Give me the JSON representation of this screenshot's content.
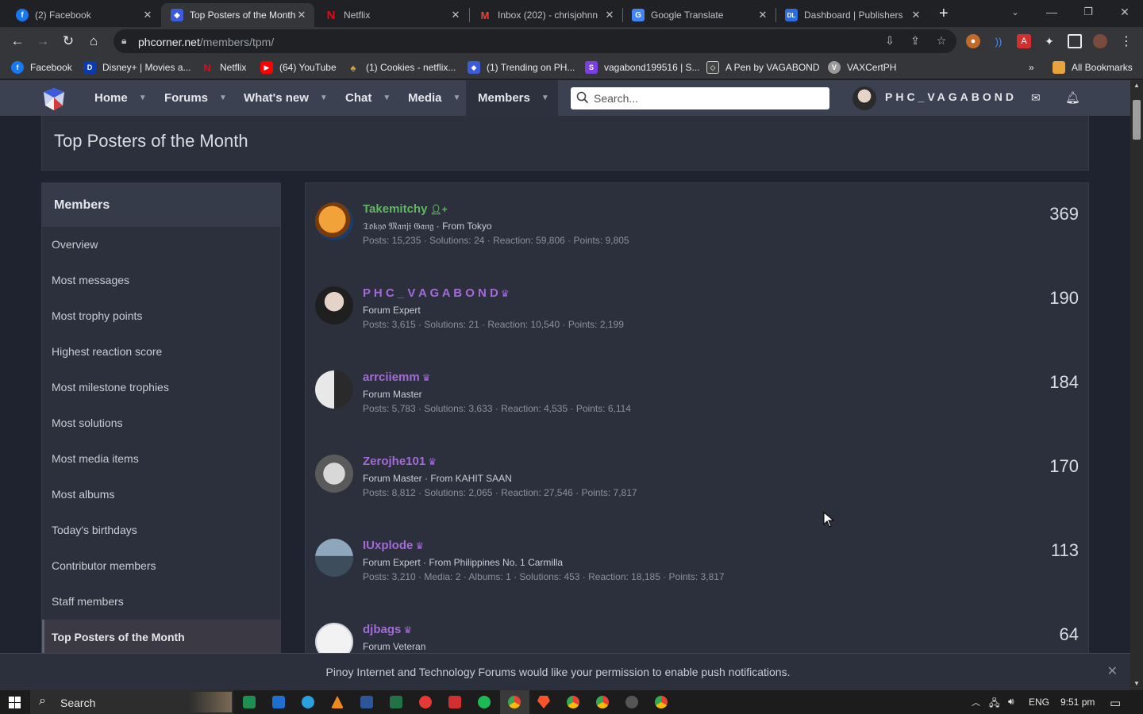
{
  "tabs": [
    {
      "title": "(2) Facebook",
      "favicon": "facebook-icon",
      "color": "#1877f2"
    },
    {
      "title": "Top Posters of the Month",
      "favicon": "phc-icon",
      "color": "#3b5bdb",
      "active": true
    },
    {
      "title": "Netflix",
      "favicon": "netflix-icon",
      "color": "#e50914"
    },
    {
      "title": "Inbox (202) - chrisjohnn",
      "favicon": "gmail-icon",
      "color": "#ea4335"
    },
    {
      "title": "Google Translate",
      "favicon": "translate-icon",
      "color": "#4285f4"
    },
    {
      "title": "Dashboard | Publishers",
      "favicon": "dl-icon",
      "color": "#2d6cdf"
    }
  ],
  "omnibox": {
    "host": "phcorner.net",
    "path": "/members/tpm/"
  },
  "bookmarks": [
    {
      "label": "Facebook",
      "color": "#1877f2"
    },
    {
      "label": "Disney+ | Movies a...",
      "color": "#0a3cb0"
    },
    {
      "label": "Netflix",
      "color": "#e50914"
    },
    {
      "label": "(64) YouTube",
      "color": "#ff0000"
    },
    {
      "label": "(1) Cookies - netflix...",
      "color": "#b5651d"
    },
    {
      "label": "(1) Trending on PH...",
      "color": "#3b5bdb"
    },
    {
      "label": "vagabond199516 | S...",
      "color": "#7b3fe4"
    },
    {
      "label": "A Pen by VAGABOND",
      "color": "#444"
    },
    {
      "label": "VAXCertPH",
      "color": "#999"
    }
  ],
  "all_bookmarks": "All Bookmarks",
  "site_nav": [
    "Home",
    "Forums",
    "What's new",
    "Chat",
    "Media",
    "Members"
  ],
  "search_placeholder": "Search...",
  "username": "PHC_VAGABOND",
  "page_title": "Top Posters of the Month",
  "sidebar": {
    "heading": "Members",
    "items": [
      "Overview",
      "Most messages",
      "Most trophy points",
      "Highest reaction score",
      "Most milestone trophies",
      "Most solutions",
      "Most media items",
      "Most albums",
      "Today's birthdays",
      "Contributor members",
      "Staff members",
      "Top Posters of the Month"
    ],
    "selected": 11
  },
  "members": [
    {
      "name": "Takemitchy",
      "color": "#5fb85f",
      "title": "𝔗𝔬𝔨𝔶𝔬 𝔐𝔞𝔫𝔧𝔦 𝔊𝔞𝔫𝔤 · From Tokyo",
      "stats": "Posts: 15,235 · Solutions: 24 · Reaction: 59,806 · Points: 9,805",
      "count": "369",
      "avatar_color": "#e07b1a"
    },
    {
      "name": "P H C _ V A G A B O N D",
      "color": "#a46ad8",
      "title": "Forum Expert",
      "stats": "Posts: 3,615 · Solutions: 21 · Reaction: 10,540 · Points: 2,199",
      "count": "190",
      "avatar_color": "#d8c2b6"
    },
    {
      "name": "arrciiemm",
      "color": "#a46ad8",
      "title": "Forum Master",
      "stats": "Posts: 5,783 · Solutions: 3,633 · Reaction: 4,535 · Points: 6,114",
      "count": "184",
      "avatar_color": "#8c8c8c"
    },
    {
      "name": "Zerojhe101",
      "color": "#a46ad8",
      "title": "Forum Master · From KAHIT SAAN",
      "stats": "Posts: 8,812 · Solutions: 2,065 · Reaction: 27,546 · Points: 7,817",
      "count": "170",
      "avatar_color": "#bdbdbd"
    },
    {
      "name": "IUxplode",
      "color": "#a46ad8",
      "title": "Forum Expert · From Philippines No. 1 Carmilla",
      "stats": "Posts: 3,210 · Media: 2 · Albums: 1 · Solutions: 453 · Reaction: 18,185 · Points: 3,817",
      "count": "113",
      "avatar_color": "#6d8aa3"
    },
    {
      "name": "djbags",
      "color": "#a46ad8",
      "title": "Forum Veteran",
      "stats": "",
      "count": "64",
      "avatar_color": "#e8e8e8"
    }
  ],
  "notification": "Pinoy Internet and Technology Forums would like your permission to enable push notifications.",
  "taskbar": {
    "search": "Search",
    "lang": "ENG",
    "time": "9:51 pm"
  }
}
